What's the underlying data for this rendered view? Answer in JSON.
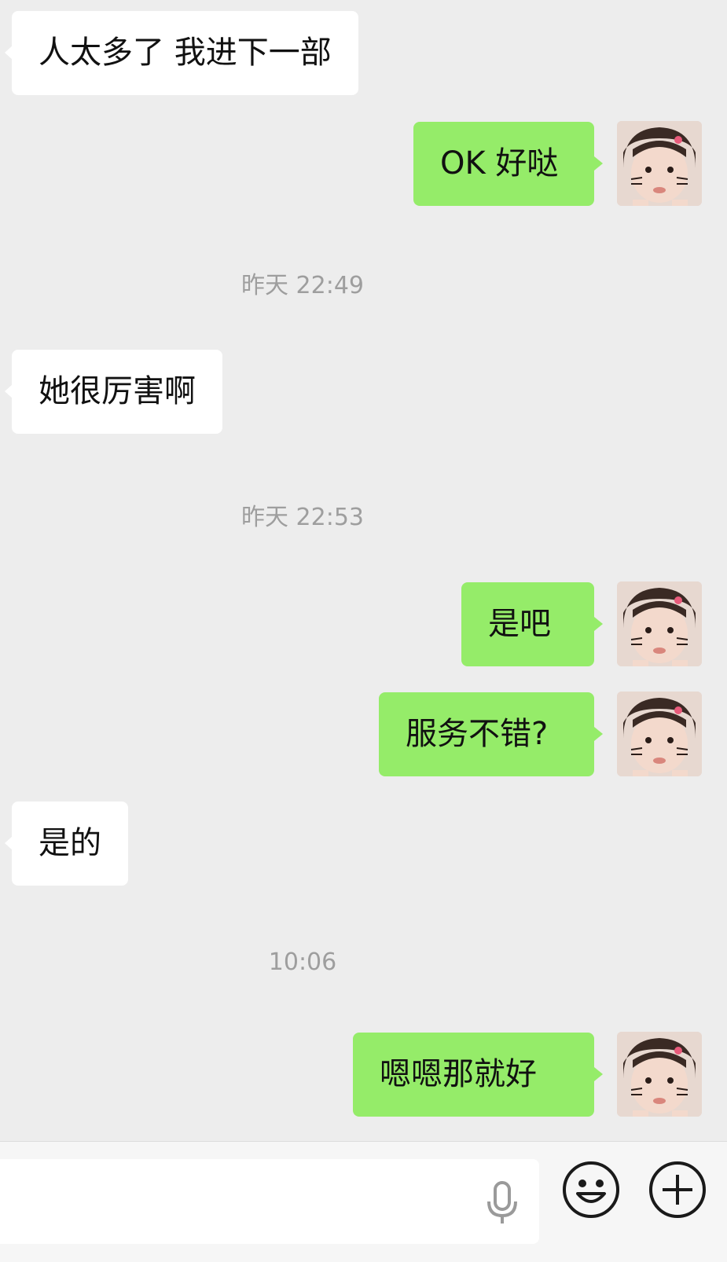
{
  "messages": [
    {
      "direction": "in",
      "text": "人太多了 我进下一部"
    },
    {
      "direction": "out",
      "text": "OK 好哒"
    },
    {
      "direction": "timestamp",
      "text": "昨天 22:49"
    },
    {
      "direction": "in",
      "text": "她很厉害啊"
    },
    {
      "direction": "timestamp",
      "text": "昨天 22:53"
    },
    {
      "direction": "out",
      "text": "是吧"
    },
    {
      "direction": "out",
      "text": "服务不错?"
    },
    {
      "direction": "in",
      "text": "是的"
    },
    {
      "direction": "timestamp",
      "text": "10:06"
    },
    {
      "direction": "out",
      "text": "嗯嗯那就好"
    }
  ],
  "input": {
    "value": "",
    "placeholder": ""
  },
  "icons": {
    "voice": "microphone-icon",
    "emoji": "emoji-icon",
    "more": "plus-icon"
  },
  "colors": {
    "background": "#ededed",
    "incoming_bubble": "#ffffff",
    "outgoing_bubble": "#95ec69",
    "timestamp": "#9e9e9e"
  }
}
